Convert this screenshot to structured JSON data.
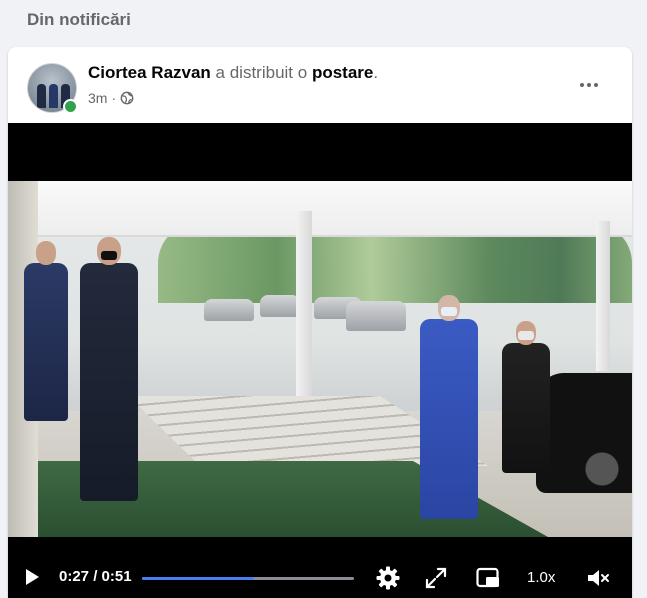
{
  "section": {
    "title": "Din notificări"
  },
  "post": {
    "author": "Ciortea Razvan",
    "action_text": " a distribuit o ",
    "post_link": "postare",
    "trailing": ".",
    "time": "3m",
    "dot": "·",
    "privacy_icon": "globe-icon",
    "menu_icon": "more-options-icon"
  },
  "video": {
    "current_time": "0:27",
    "duration": "0:51",
    "time_separator": " / ",
    "progress": 0.53,
    "speed": "1.0x",
    "icons": [
      "play-icon",
      "settings-gear-icon",
      "fullscreen-icon",
      "picture-in-picture-icon",
      "muted-volume-icon"
    ]
  },
  "colors": {
    "accent": "#4a7ff0",
    "online": "#31a24c",
    "secondary_text": "#65676b",
    "primary_text": "#050505"
  }
}
